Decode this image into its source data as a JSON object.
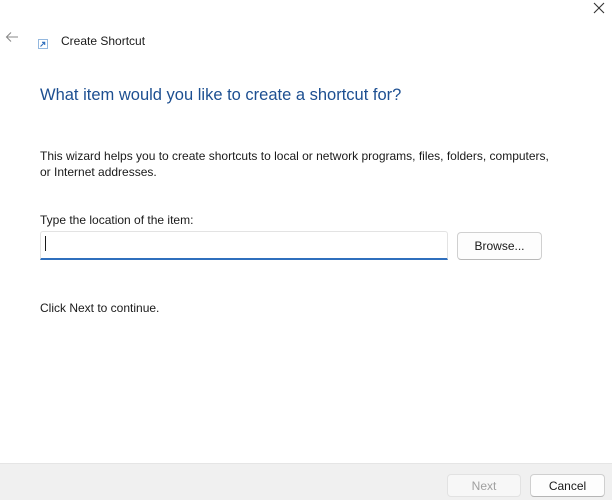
{
  "window": {
    "title": "Create Shortcut",
    "close_icon": "close-icon",
    "back_icon": "back-arrow-icon",
    "app_icon": "shortcut-icon"
  },
  "main": {
    "heading": "What item would you like to create a shortcut for?",
    "description": "This wizard helps you to create shortcuts to local or network programs, files, folders, computers, or Internet addresses.",
    "location_label": "Type the location of the item:",
    "location_value": "",
    "browse_label": "Browse...",
    "continue_text": "Click Next to continue."
  },
  "footer": {
    "next_label": "Next",
    "next_enabled": false,
    "cancel_label": "Cancel"
  },
  "colors": {
    "heading": "#1d4f91",
    "accent": "#2f6fbd",
    "footer_bg": "#f0f0f0"
  }
}
